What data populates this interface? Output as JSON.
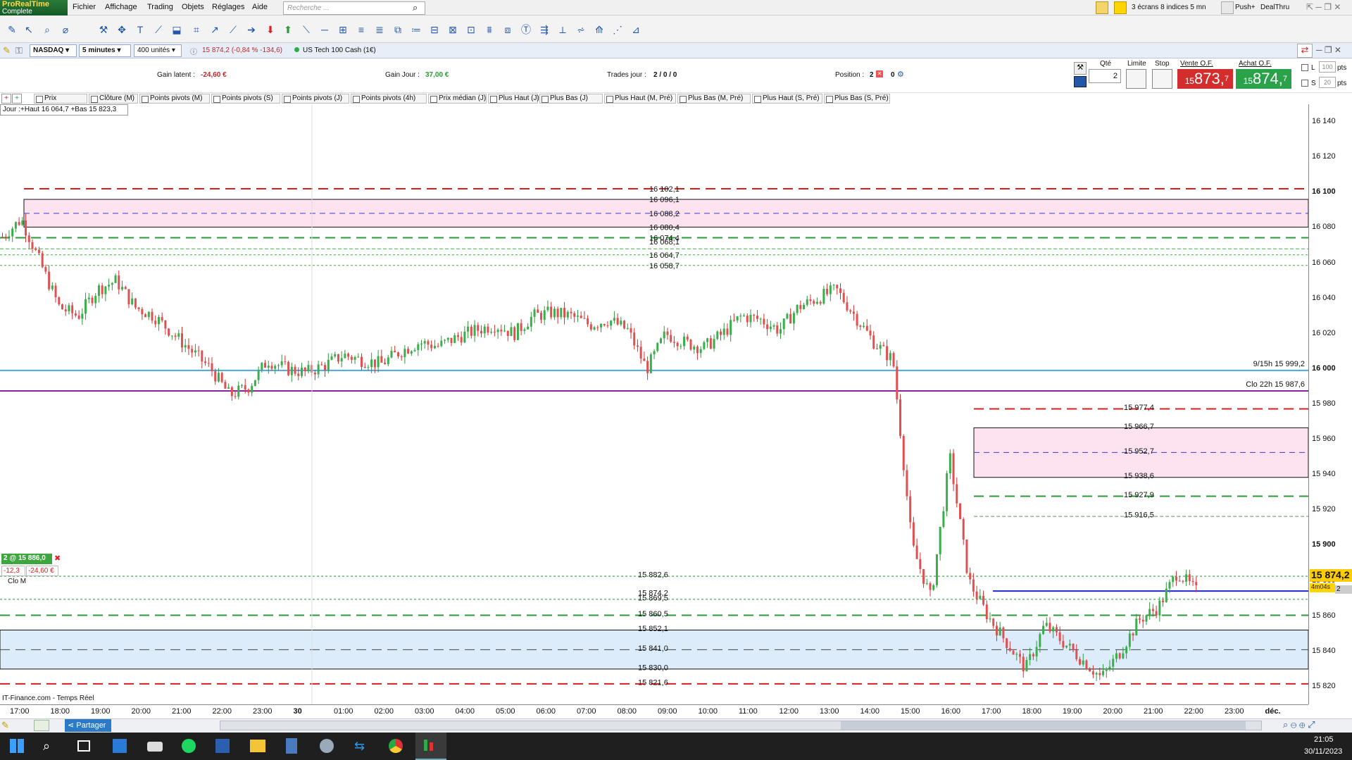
{
  "app": {
    "logo_line1": "ProRealTime",
    "logo_line2": "Complete"
  },
  "menu": [
    "Fichier",
    "Affichage",
    "Trading",
    "Objets",
    "Réglages",
    "Aide"
  ],
  "search": {
    "placeholder": "Recherche ..."
  },
  "topright": {
    "layout": "3 écrans 8 indices 5 mn",
    "push": "Push+",
    "dealthru": "DealThru"
  },
  "instrument": {
    "market": "NASDAQ",
    "timeframe": "5 minutes",
    "units": "400 unités",
    "price_change": "15 874,2 (-0,84 % -134,6)",
    "name": "US Tech 100 Cash (1€)"
  },
  "info": {
    "gain_latent_label": "Gain latent :",
    "gain_latent": "-24,60 €",
    "gain_jour_label": "Gain Jour :",
    "gain_jour": "37,00 €",
    "trades_label": "Trades jour :",
    "trades": "2 / 0 / 0",
    "position_label": "Position :",
    "position_a": "2",
    "position_b": "0"
  },
  "order": {
    "qte_label": "Qté",
    "qte": "2",
    "limite_label": "Limite",
    "stop_label": "Stop",
    "vente_label": "Vente O.F.",
    "achat_label": "Achat O.F.",
    "vente_small": "15",
    "vente_big": "873,",
    "vente_sup": "7",
    "achat_small": "15",
    "achat_big": "874,",
    "achat_sup": "7",
    "l_label": "L",
    "s_label": "S",
    "l_val": "100",
    "s_val": "20",
    "pts": "pts"
  },
  "indicators": [
    "Prix",
    "Clôture (M)",
    "Points pivots (M)",
    "Points pivots (S)",
    "Points pivots (J)",
    "Points pivots (4h)",
    "Prix médian (J)",
    "Plus Haut (J)",
    "Plus Bas (J)",
    "Plus Haut (M, Pré)",
    "Plus Bas (M, Pré)",
    "Plus Haut (S, Pré)",
    "Plus Bas (S, Pré)"
  ],
  "jour_label": "Jour :+Haut 16 064,7 +Bas 15 823,3",
  "position_box": {
    "title": "2 @ 15 886,0",
    "pnl_pts": "-12,3",
    "pnl_eur": "-24,60 €",
    "clo": "Clo M"
  },
  "source": "IT-Finance.com - Temps Réel",
  "price_tag": "15 874,2",
  "countdown": "4m04s",
  "countdown_tail": "2",
  "taskbar": {
    "share": "Partager",
    "time": "21:05",
    "date": "30/11/2023"
  },
  "chart_data": {
    "type": "candlestick",
    "instrument": "US Tech 100 Cash",
    "timeframe": "5 minutes",
    "ylim": [
      15810,
      16150
    ],
    "y_ticks": [
      16140,
      16120,
      16100,
      16080,
      16060,
      16040,
      16020,
      16000,
      15980,
      15960,
      15940,
      15920,
      15900,
      15880,
      15860,
      15840,
      15820
    ],
    "y_bold": [
      16100,
      16000,
      15900
    ],
    "x_ticks": [
      "17:00",
      "18:00",
      "19:00",
      "20:00",
      "21:00",
      "22:00",
      "23:00",
      "30",
      "01:00",
      "02:00",
      "03:00",
      "04:00",
      "05:00",
      "06:00",
      "07:00",
      "08:00",
      "09:00",
      "10:00",
      "11:00",
      "12:00",
      "13:00",
      "14:00",
      "15:00",
      "16:00",
      "17:00",
      "18:00",
      "19:00",
      "20:00",
      "21:00",
      "22:00",
      "23:00",
      "déc."
    ],
    "level_labels_left": [
      "16 102,1",
      "16 096,1",
      "16 088,2",
      "16 080,4",
      "16 074,4",
      "16 068,1",
      "16 064,7",
      "16 058,7"
    ],
    "level_labels_right": [
      "15 977,4",
      "15 966,7",
      "15 952,7",
      "15 938,6",
      "15 927,9",
      "15 916,5"
    ],
    "level_labels_bottom": [
      "15 882,6",
      "15 874,2",
      "15 869,5",
      "15 860,5",
      "15 852,1",
      "15 841,0",
      "15 830,0",
      "15 821,6"
    ],
    "annotations": [
      "9/15h 15 999,2",
      "Clo 22h 15 987,6"
    ],
    "last_price": 15874.2,
    "day_high": 16064.7,
    "day_low": 15823.3,
    "trend": [
      16075,
      16085,
      16060,
      16035,
      16030,
      16045,
      16050,
      16035,
      16030,
      16020,
      16010,
      16000,
      15985,
      15990,
      16005,
      16000,
      15998,
      16002,
      16008,
      16005,
      16003,
      16010,
      16015,
      16013,
      16018,
      16022,
      16025,
      16020,
      16030,
      16032,
      16030,
      16025,
      16028,
      16022,
      16000,
      16020,
      16015,
      16012,
      16020,
      16030,
      16028,
      16022,
      16035,
      16040,
      16045,
      16030,
      16015,
      16005,
      15900,
      15870,
      15950,
      15880,
      15860,
      15845,
      15830,
      15855,
      15845,
      15835,
      15825,
      15840,
      15858,
      15865,
      15885,
      15874
    ]
  }
}
